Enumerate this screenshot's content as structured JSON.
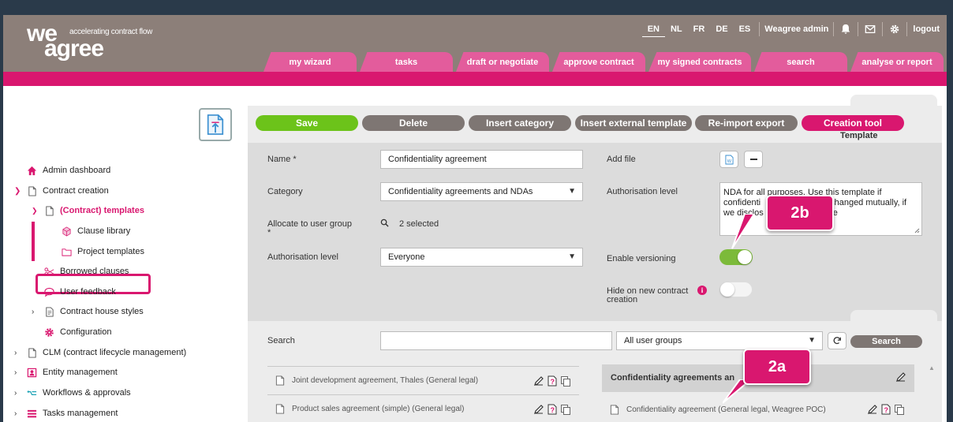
{
  "header": {
    "logo_we": "we",
    "logo_agree": "agree",
    "logo_tagline": "accelerating contract flow",
    "languages": [
      "EN",
      "NL",
      "FR",
      "DE",
      "ES"
    ],
    "active_language": "EN",
    "user": "Weagree admin",
    "logout": "logout",
    "tabs": [
      "my wizard",
      "tasks",
      "draft or negotiate",
      "approve contract",
      "my signed contracts",
      "search",
      "analyse or report"
    ]
  },
  "sidebar": {
    "items": [
      {
        "label": "Admin dashboard",
        "icon": "home-icon"
      },
      {
        "label": "Contract creation",
        "icon": "document-icon"
      },
      {
        "label": "(Contract) templates",
        "icon": "document-icon"
      },
      {
        "label": "Clause library",
        "icon": "cube-icon"
      },
      {
        "label": "Project templates",
        "icon": "folder-icon"
      },
      {
        "label": "Borrowed clauses",
        "icon": "scissors-icon"
      },
      {
        "label": "User feedback",
        "icon": "chat-icon"
      },
      {
        "label": "Contract house styles",
        "icon": "stylesheet-icon"
      },
      {
        "label": "Configuration",
        "icon": "gear-icon"
      },
      {
        "label": "CLM (contract lifecycle management)",
        "icon": "document-icon"
      },
      {
        "label": "Entity management",
        "icon": "contact-card-icon"
      },
      {
        "label": "Workflows & approvals",
        "icon": "workflow-icon"
      },
      {
        "label": "Tasks management",
        "icon": "list-icon"
      }
    ]
  },
  "toolbar": {
    "save": "Save",
    "delete": "Delete",
    "insert_category": "Insert category",
    "insert_external": "Insert external template",
    "reimport": "Re-import export",
    "creation_tool": "Creation tool",
    "template_label": "Template"
  },
  "form": {
    "name_label": "Name *",
    "name_value": "Confidentiality agreement",
    "category_label": "Category",
    "category_value": "Confidentiality agreements and NDAs",
    "allocate_label": "Allocate to user group",
    "allocate_required": "*",
    "allocate_value": "2 selected",
    "auth_level_label": "Authorisation level",
    "auth_level_value": "Everyone",
    "add_file_label": "Add file",
    "auth_text_label": "Authorisation level",
    "auth_text_line1": "NDA for all purposes. Use this template if",
    "auth_text_line2a": "confidenti",
    "auth_text_line2b": "changed mutually, if",
    "auth_text_line3a": "we disclos",
    "auth_text_line3b": "e",
    "versioning_label": "Enable versioning",
    "versioning_on": true,
    "hide_label_1": "Hide on new contract",
    "hide_label_2": "creation",
    "hide_on": false
  },
  "search": {
    "label": "Search",
    "value": "",
    "groups_value": "All user groups",
    "button": "Search"
  },
  "left_list": [
    "Joint development agreement, Thales (General legal)",
    "Product sales agreement (simple) (General legal)"
  ],
  "right_panel": {
    "header": "Confidentiality agreements an",
    "item": "Confidentiality agreement (General legal, Weagree POC)"
  },
  "callouts": {
    "a": "2a",
    "b": "2b"
  },
  "colors": {
    "brand_pink": "#d9176f",
    "header_taupe": "#8c7f79",
    "save_green": "#6cc31a",
    "gray_button": "#7e7673"
  }
}
